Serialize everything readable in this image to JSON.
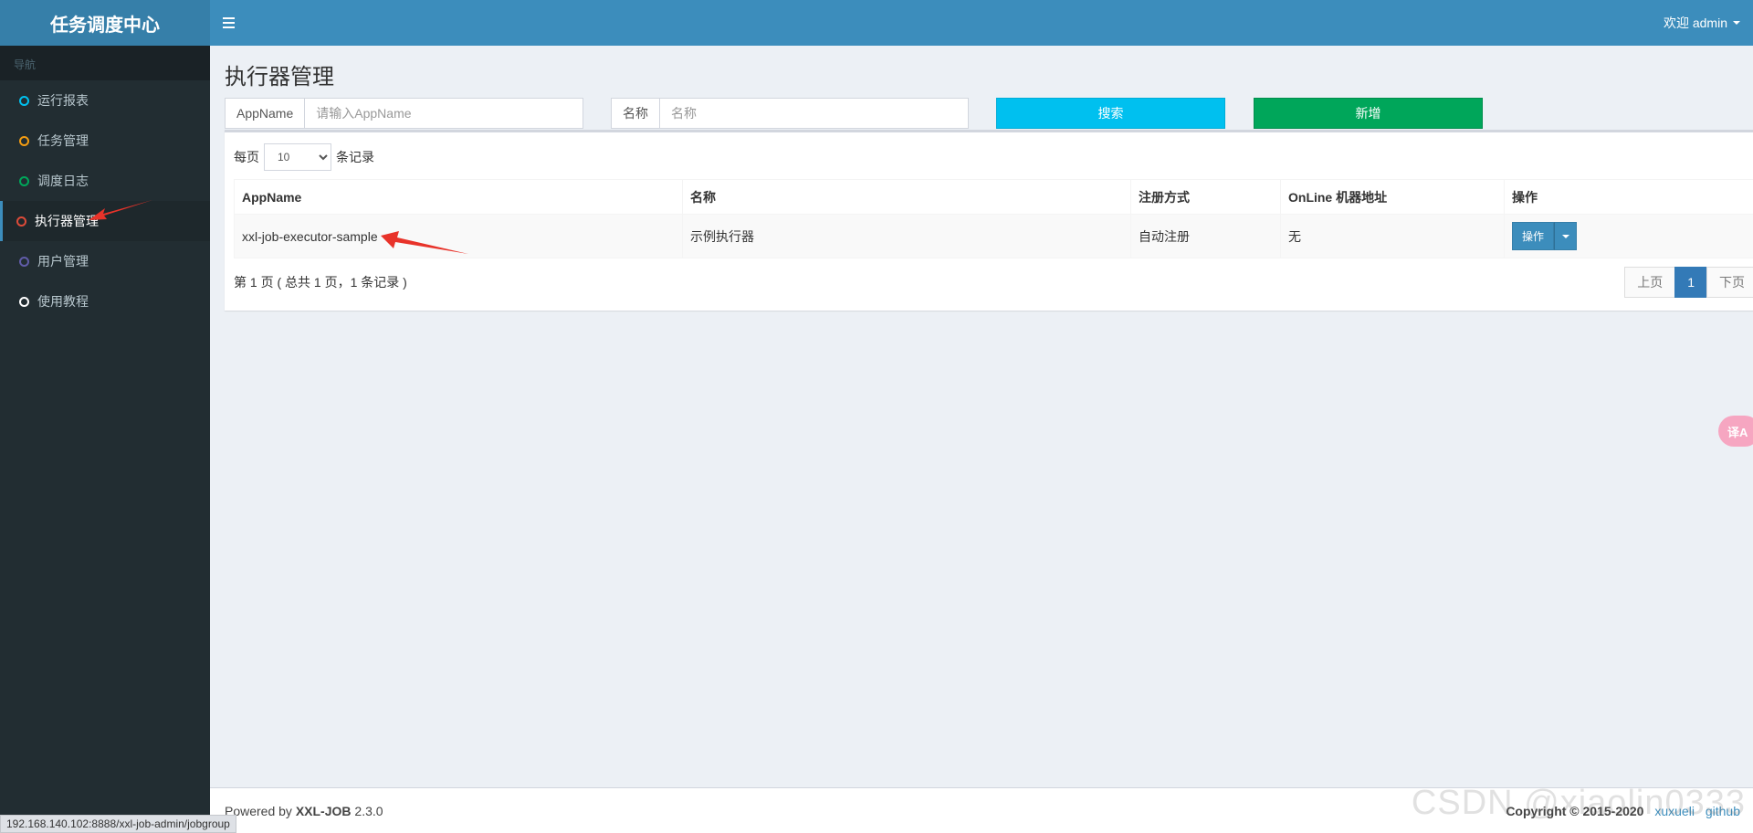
{
  "app": {
    "title": "任务调度中心"
  },
  "header": {
    "user_label": "欢迎 admin"
  },
  "sidebar": {
    "header": "导航",
    "items": [
      {
        "label": "运行报表",
        "circle_color": "#00c0ef",
        "active": false
      },
      {
        "label": "任务管理",
        "circle_color": "#f39c12",
        "active": false
      },
      {
        "label": "调度日志",
        "circle_color": "#00a65a",
        "active": false
      },
      {
        "label": "执行器管理",
        "circle_color": "#dd4b39",
        "active": true
      },
      {
        "label": "用户管理",
        "circle_color": "#605ca8",
        "active": false
      },
      {
        "label": "使用教程",
        "circle_color": "#ffffff",
        "active": false
      }
    ]
  },
  "main": {
    "page_title": "执行器管理",
    "filters": {
      "appname_label": "AppName",
      "appname_placeholder": "请输入AppName",
      "name_label": "名称",
      "name_placeholder": "名称"
    },
    "buttons": {
      "search": "搜索",
      "add": "新增"
    },
    "length": {
      "prefix": "每页",
      "value": "10",
      "suffix": "条记录"
    },
    "table": {
      "headers": [
        "AppName",
        "名称",
        "注册方式",
        "OnLine 机器地址",
        "操作"
      ],
      "rows": [
        {
          "appname": "xxl-job-executor-sample",
          "name": "示例执行器",
          "register": "自动注册",
          "online": "无",
          "action": "操作"
        }
      ]
    },
    "info": "第 1 页 ( 总共 1 页，1 条记录 )",
    "pagination": {
      "prev": "上页",
      "current": "1",
      "next": "下页"
    }
  },
  "footer": {
    "powered_prefix": "Powered by",
    "powered_brand": "XXL-JOB",
    "version": "2.3.0",
    "copyright_prefix": "Copyright ©",
    "copyright_years": "2015-2020",
    "author_link": "xuxueli",
    "github_link": "github"
  },
  "status_url": "192.168.140.102:8888/xxl-job-admin/jobgroup",
  "watermark": "CSDN @xiaolin0333",
  "translate_widget": "译A",
  "colors": {
    "header": "#3c8dbc",
    "logo": "#367fa9",
    "sidebar": "#222d32",
    "search_btn": "#00c0ef",
    "add_btn": "#00a65a",
    "annotation_arrow": "#e8332a"
  }
}
